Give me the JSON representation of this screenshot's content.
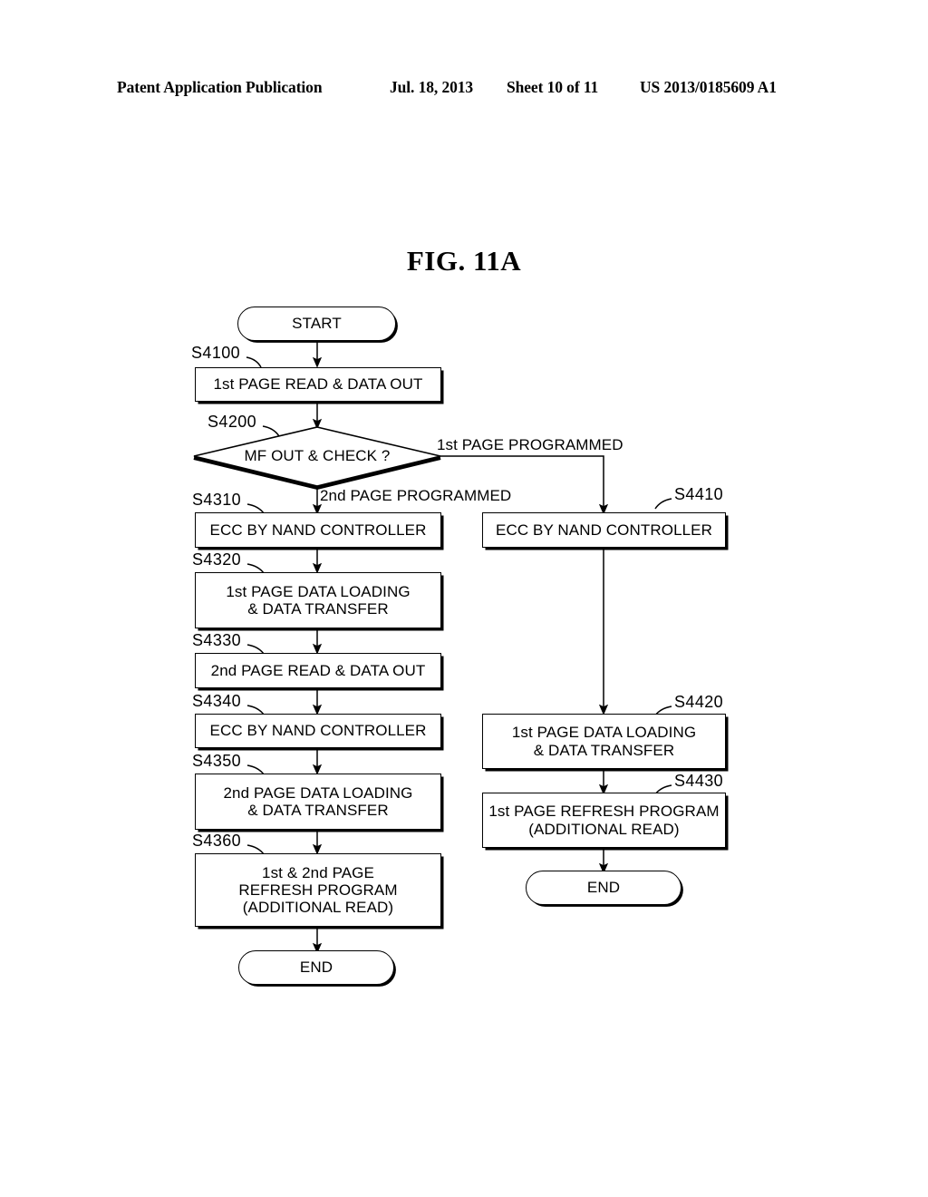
{
  "header": {
    "publication": "Patent Application Publication",
    "date": "Jul. 18, 2013",
    "sheet": "Sheet 10 of 11",
    "number": "US 2013/0185609 A1"
  },
  "figure": {
    "title": "FIG. 11A"
  },
  "flowchart": {
    "start": {
      "label": "START"
    },
    "decision": {
      "step": "S4200",
      "text": "MF OUT & CHECK ?",
      "branch_right": "1st PAGE PROGRAMMED",
      "branch_down": "2nd PAGE PROGRAMMED"
    },
    "nodes": {
      "s4100": {
        "step": "S4100",
        "text": "1st PAGE READ & DATA OUT"
      },
      "s4310": {
        "step": "S4310",
        "text": "ECC BY NAND CONTROLLER"
      },
      "s4320": {
        "step": "S4320",
        "text": "1st PAGE DATA LOADING\n& DATA TRANSFER"
      },
      "s4330": {
        "step": "S4330",
        "text": "2nd PAGE READ & DATA OUT"
      },
      "s4340": {
        "step": "S4340",
        "text": "ECC BY NAND CONTROLLER"
      },
      "s4350": {
        "step": "S4350",
        "text": "2nd PAGE DATA LOADING\n& DATA TRANSFER"
      },
      "s4360": {
        "step": "S4360",
        "text": "1st & 2nd PAGE\nREFRESH PROGRAM\n(ADDITIONAL READ)"
      },
      "s4410": {
        "step": "S4410",
        "text": "ECC BY NAND CONTROLLER"
      },
      "s4420": {
        "step": "S4420",
        "text": "1st PAGE DATA LOADING\n& DATA TRANSFER"
      },
      "s4430": {
        "step": "S4430",
        "text": "1st PAGE REFRESH PROGRAM\n(ADDITIONAL READ)"
      }
    },
    "end_left": {
      "label": "END"
    },
    "end_right": {
      "label": "END"
    }
  }
}
